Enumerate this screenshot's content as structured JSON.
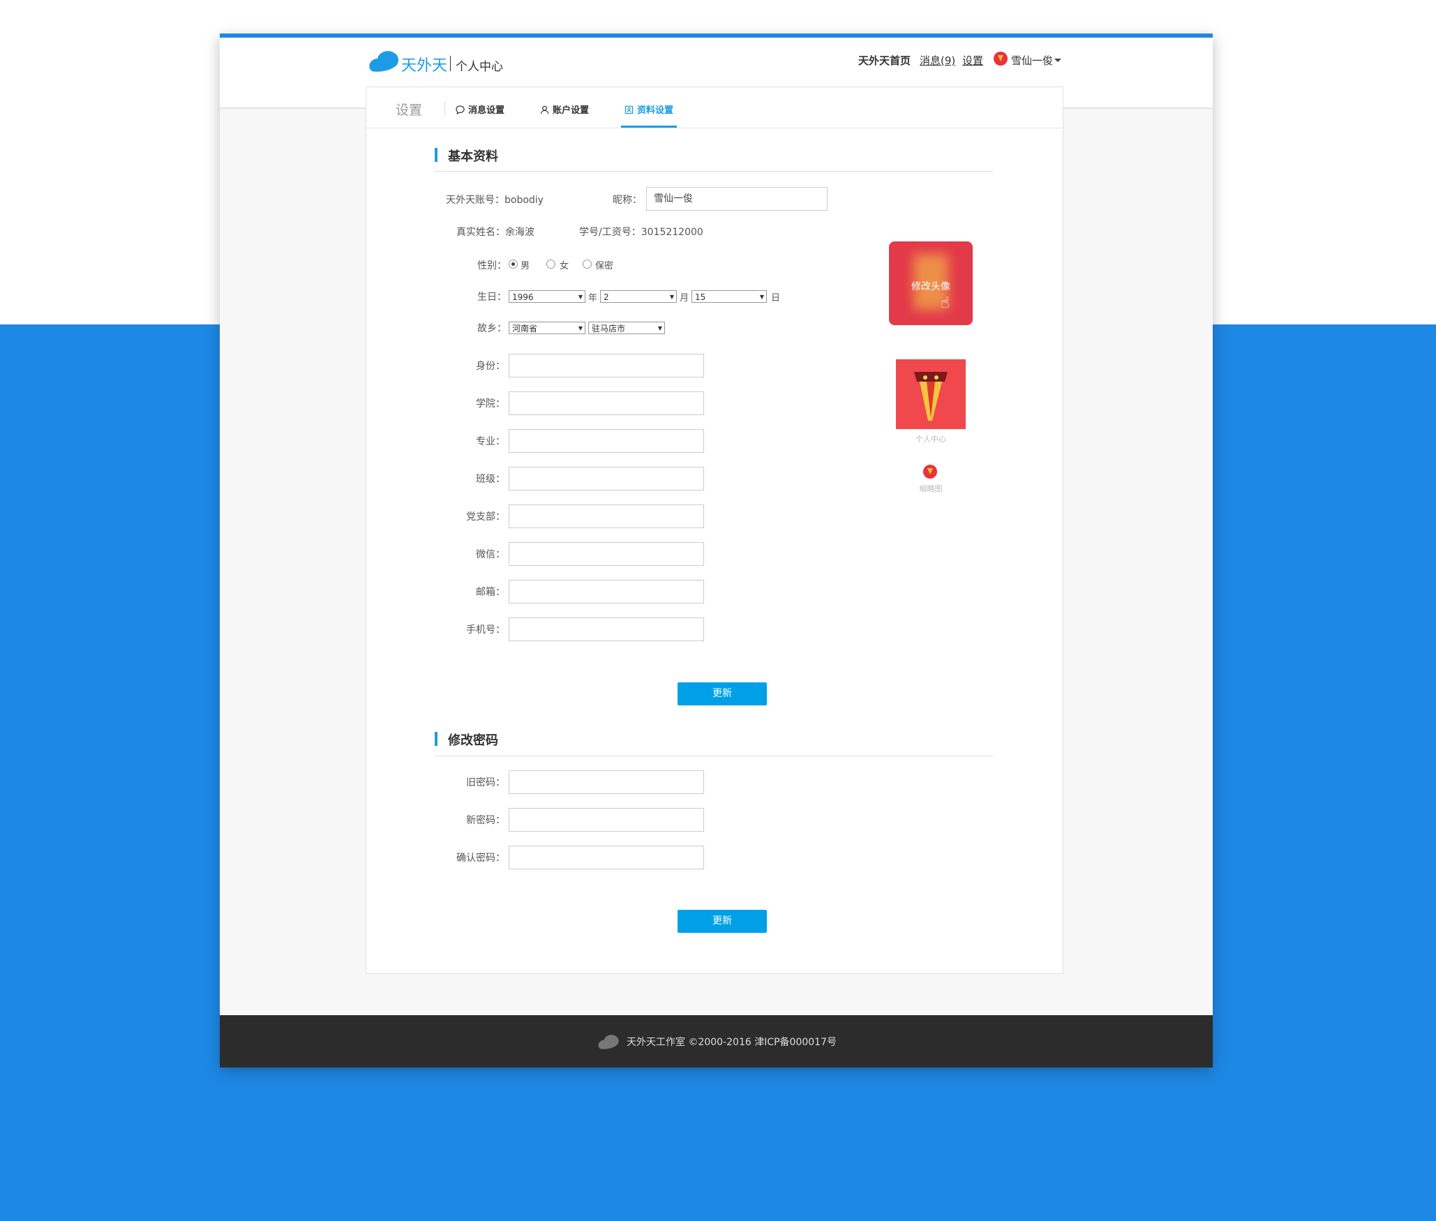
{
  "header": {
    "brand": "天外天",
    "subtitle": "个人中心",
    "nav": {
      "home": "天外天首页",
      "messages": "消息(9)",
      "settings": "设置",
      "user": "雪仙一俊"
    }
  },
  "tabs": {
    "title": "设置",
    "items": [
      "消息设置",
      "账户设置",
      "资料设置"
    ],
    "active": "资料设置"
  },
  "basic": {
    "title": "基本资料",
    "account_label": "天外天账号：bobodiy",
    "nickname_label": "昵称：",
    "nickname_value": "雪仙一俊",
    "realname_label": "真实姓名：余海波",
    "id_label": "学号/工资号：3015212000",
    "gender_label": "性别：",
    "gender_options": [
      "男",
      "女",
      "保密"
    ],
    "gender_selected": "男",
    "birthday_label": "生日：",
    "birthday": {
      "year": "1996",
      "year_unit": "年",
      "month": "2",
      "month_unit": "月",
      "day": "15",
      "day_unit": "日"
    },
    "hometown_label": "故乡：",
    "hometown": {
      "province": "河南省",
      "city": "驻马店市"
    },
    "fields": [
      "身份：",
      "学院：",
      "专业：",
      "班级：",
      "党支部：",
      "微信：",
      "邮箱：",
      "手机号："
    ],
    "submit": "更新"
  },
  "avatar": {
    "edit": "修改头像",
    "mid_caption": "个人中心",
    "small_caption": "缩略图"
  },
  "password": {
    "title": "修改密码",
    "fields": [
      "旧密码：",
      "新密码：",
      "确认密码："
    ],
    "submit": "更新"
  },
  "footer": {
    "text": "天外天工作室 ©2000-2016 津ICP备000017号"
  },
  "colors": {
    "accent": "#1e9be6",
    "page_bg": "#1e88e5",
    "button": "#00a0e9",
    "footer": "#2c2c2c"
  }
}
